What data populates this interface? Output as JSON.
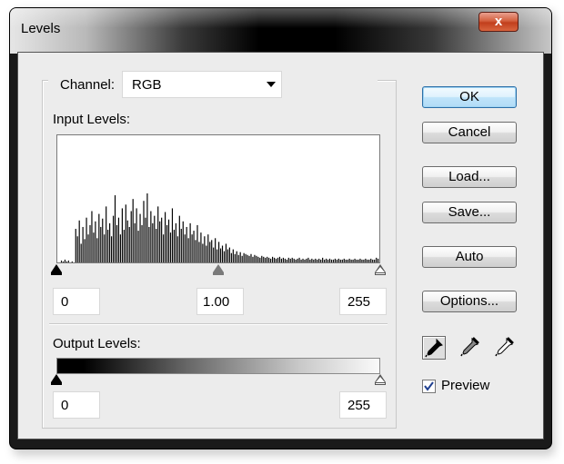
{
  "window": {
    "title": "Levels",
    "close_label": "x"
  },
  "channel": {
    "label": "Channel:",
    "value": "RGB"
  },
  "input_levels": {
    "label": "Input Levels:",
    "black": "0",
    "gamma": "1.00",
    "white": "255",
    "histogram": [
      0,
      0,
      2,
      1,
      3,
      1,
      2,
      0,
      1,
      0,
      36,
      28,
      45,
      20,
      38,
      25,
      48,
      30,
      40,
      55,
      32,
      44,
      26,
      52,
      38,
      47,
      30,
      60,
      35,
      42,
      28,
      50,
      72,
      40,
      48,
      30,
      58,
      35,
      62,
      45,
      38,
      55,
      68,
      42,
      58,
      34,
      52,
      40,
      66,
      48,
      74,
      38,
      55,
      42,
      50,
      36,
      60,
      44,
      48,
      30,
      54,
      40,
      46,
      32,
      58,
      35,
      42,
      28,
      50,
      36,
      44,
      30,
      38,
      26,
      42,
      30,
      34,
      24,
      40,
      22,
      32,
      20,
      28,
      18,
      30,
      22,
      24,
      16,
      26,
      14,
      22,
      15,
      18,
      12,
      20,
      14,
      16,
      10,
      14,
      9,
      12,
      8,
      11,
      7,
      10,
      9,
      8,
      7,
      9,
      6,
      8,
      7,
      6,
      5,
      7,
      6,
      5,
      6,
      5,
      4,
      6,
      5,
      4,
      5,
      6,
      4,
      5,
      4,
      3,
      5,
      4,
      5,
      4,
      3,
      4,
      5,
      3,
      4,
      3,
      4,
      5,
      3,
      4,
      3,
      4,
      3,
      4,
      3,
      5,
      3,
      4,
      3,
      4,
      3,
      3,
      4,
      3,
      4,
      3,
      3,
      4,
      3,
      3,
      4,
      3,
      3,
      4,
      3,
      3,
      4,
      3,
      3,
      4,
      3,
      3,
      4,
      3,
      3,
      5,
      4
    ]
  },
  "output_levels": {
    "label": "Output Levels:",
    "black": "0",
    "white": "255"
  },
  "buttons": {
    "ok": "OK",
    "cancel": "Cancel",
    "load": "Load...",
    "save": "Save...",
    "auto": "Auto",
    "options": "Options..."
  },
  "preview": {
    "label": "Preview",
    "checked": true
  }
}
